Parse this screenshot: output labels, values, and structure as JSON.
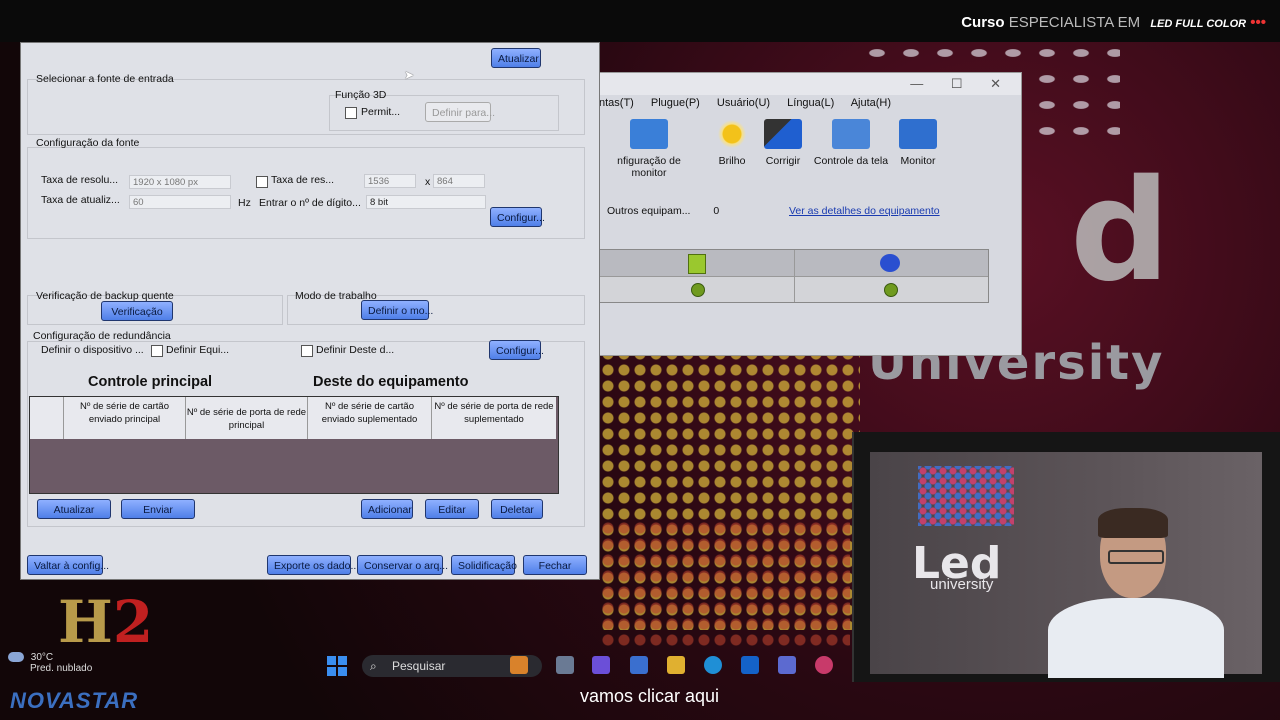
{
  "course_banner": {
    "prefix": "Curso",
    "middle": "ESPECIALISTA EM",
    "suffix": "LED FULL COLOR"
  },
  "background_brand": {
    "big": "d",
    "word": "University"
  },
  "app_window": {
    "menu": [
      "ntas(T)",
      "Plugue(P)",
      "Usuário(U)",
      "Língua(L)",
      "Ajuta(H)"
    ],
    "tools": [
      "nfiguração de monitor",
      "Brilho",
      "Corrigir",
      "Controle da tela",
      "Monitor"
    ],
    "equipment_label": "Outros equipam...",
    "equipment_count": "0",
    "details_link": "Ver as detalhes do equipamento",
    "window_controls": "— ☐ ✕"
  },
  "dialog": {
    "update_top": "Atualizar",
    "input_source_label": "Selecionar a fonte de entrada",
    "func3d_label": "Função 3D",
    "permit_label": "Permit...",
    "define_for": "Definir para...",
    "source_config_label": "Configuração da fonte",
    "resolution_label": "Taxa de resolu...",
    "resolution_value": "1920 x 1080 px",
    "refresh_label": "Taxa de atualiz...",
    "refresh_value": "60",
    "hz": "Hz",
    "res_rate_label": "Taxa de res...",
    "res_w": "1536",
    "x": "x",
    "res_h": "864",
    "digits_label": "Entrar o nº de dígito...",
    "digits_value": "8 bit",
    "configure": "Configur...",
    "hot_backup_label": "Verificação de backup quente",
    "verify_button": "Verificação",
    "work_mode_label": "Modo de trabalho",
    "define_mode_button": "Definir o mo...",
    "redundancy_label": "Configuração de redundância",
    "define_device_label": "Definir o dispositivo ...",
    "define_equip_label": "Definir Equi...",
    "define_this_label": "Definir Deste d...",
    "configure2": "Configur...",
    "heading_main": "Controle principal",
    "heading_this": "Deste do equipamento",
    "table_headers": [
      "Nº de série  de cartão enviado principal",
      "Nº de série de porta de rede principal",
      "Nº de série de cartão enviado suplementado",
      "Nº de série de porta de rede suplementado"
    ],
    "btn_update": "Atualizar",
    "btn_send": "Enviar",
    "btn_add": "Adicionar",
    "btn_edit": "Editar",
    "btn_delete": "Deletar",
    "btn_back": "Valtar à config...",
    "btn_export": "Exporte os dado...",
    "btn_save": "Conservar o arq...",
    "btn_solidify": "Solidificação",
    "btn_close": "Fechar"
  },
  "taskbar": {
    "temperature": "30°C",
    "weather": "Pred. nublado",
    "search": "Pesquisar"
  },
  "logos": {
    "h2": "H",
    "h2_num": "2",
    "novastar": "NOVASTAR"
  },
  "webcam": {
    "logo": "Led",
    "logo_sub": "university"
  },
  "subtitle": "vamos clicar aqui"
}
